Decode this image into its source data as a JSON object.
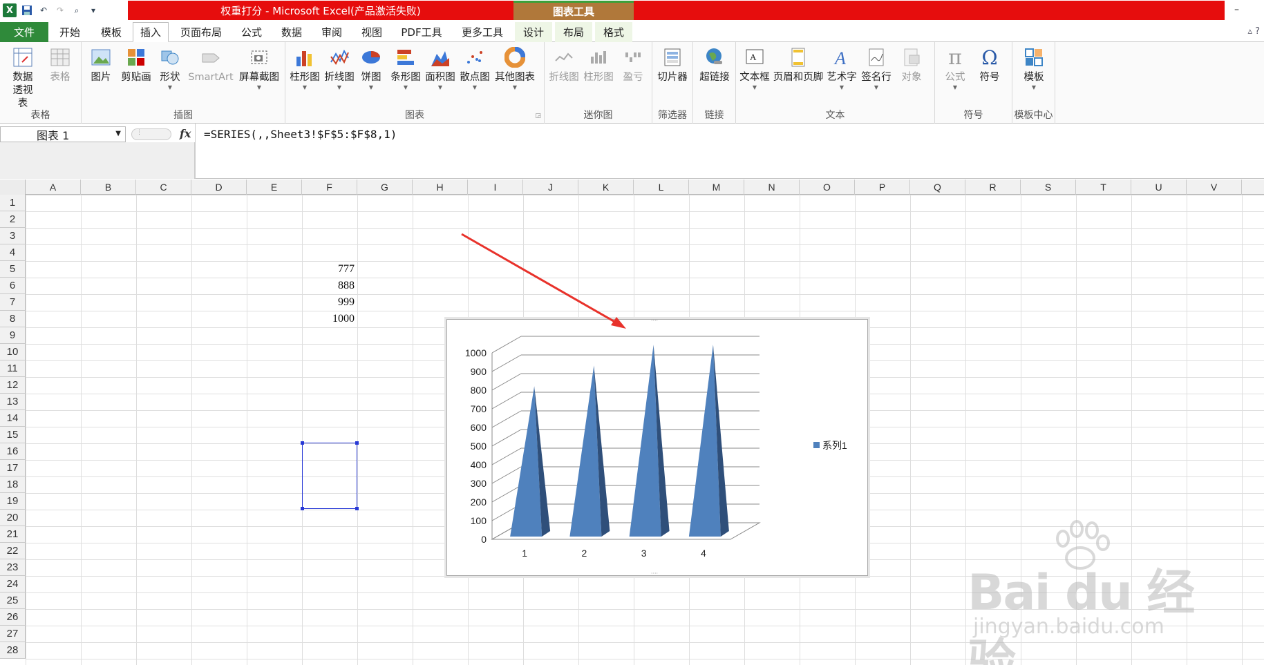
{
  "window": {
    "title": "权重打分 - Microsoft Excel(产品激活失败)",
    "context_tools": "图表工具",
    "min_button": "–"
  },
  "tabs": {
    "file": "文件",
    "items": [
      "开始",
      "模板",
      "插入",
      "页面布局",
      "公式",
      "数据",
      "审阅",
      "视图",
      "PDF工具",
      "更多工具"
    ],
    "context": [
      "设计",
      "布局",
      "格式"
    ],
    "right_icons": "▵ ?"
  },
  "ribbon": {
    "groups": {
      "table": "表格",
      "illustrations": "插图",
      "charts": "图表",
      "sparklines": "迷你图",
      "filter": "筛选器",
      "links": "链接",
      "text": "文本",
      "symbols": "符号",
      "templates": "模板中心"
    },
    "buttons": {
      "pivot": "数据透视表",
      "table": "表格",
      "picture": "图片",
      "clipart": "剪贴画",
      "shapes": "形状",
      "smartart": "SmartArt",
      "screenshot": "屏幕截图",
      "column": "柱形图",
      "line": "折线图",
      "pie": "饼图",
      "bar": "条形图",
      "area": "面积图",
      "scatter": "散点图",
      "other_charts": "其他图表",
      "sp_line": "折线图",
      "sp_column": "柱形图",
      "sp_winloss": "盈亏",
      "slicer": "切片器",
      "hyperlink": "超链接",
      "textbox": "文本框",
      "header_footer": "页眉和页脚",
      "wordart": "艺术字",
      "signature": "签名行",
      "object": "对象",
      "equation": "公式",
      "symbol": "符号",
      "template": "模板"
    }
  },
  "formula_bar": {
    "name_box": "图表 1",
    "fx": "fx",
    "formula": "=SERIES(,,Sheet3!$F$5:$F$8,1)"
  },
  "sheet": {
    "columns": [
      "A",
      "B",
      "C",
      "D",
      "E",
      "F",
      "G",
      "H",
      "I",
      "J",
      "K",
      "L",
      "M",
      "N",
      "O",
      "P",
      "Q",
      "R",
      "S",
      "T",
      "U",
      "V"
    ],
    "rows": [
      "1",
      "2",
      "3",
      "4",
      "5",
      "6",
      "7",
      "8",
      "9",
      "10",
      "11",
      "12",
      "13",
      "14",
      "15",
      "16",
      "17",
      "18",
      "19",
      "20",
      "21",
      "22",
      "23",
      "24",
      "25",
      "26",
      "27",
      "28"
    ],
    "cells": {
      "F5": "777",
      "F6": "888",
      "F7": "999",
      "F8": "1000"
    }
  },
  "chart_data": {
    "type": "bar",
    "categories": [
      "1",
      "2",
      "3",
      "4"
    ],
    "series": [
      {
        "name": "系列1",
        "values": [
          777,
          888,
          999,
          1000
        ],
        "color": "#4f81bd"
      }
    ],
    "ylim": [
      0,
      1000
    ],
    "yticks": [
      "0",
      "100",
      "200",
      "300",
      "400",
      "500",
      "600",
      "700",
      "800",
      "900",
      "1000"
    ],
    "grid": true,
    "legend": "right",
    "shape": "3d-pyramid"
  },
  "watermark": {
    "logo": "Bai du 经验",
    "url": "jingyan.baidu.com"
  }
}
